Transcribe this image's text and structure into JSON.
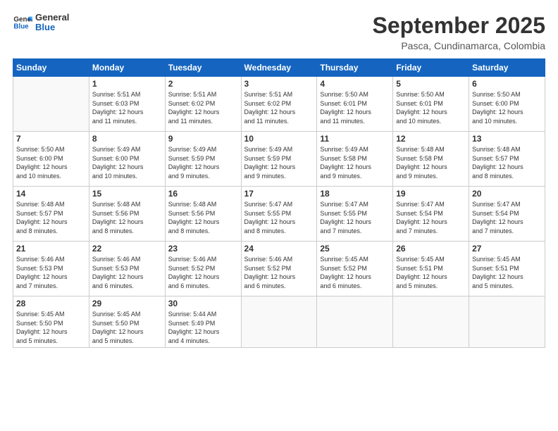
{
  "logo": {
    "line1": "General",
    "line2": "Blue"
  },
  "title": "September 2025",
  "subtitle": "Pasca, Cundinamarca, Colombia",
  "weekdays": [
    "Sunday",
    "Monday",
    "Tuesday",
    "Wednesday",
    "Thursday",
    "Friday",
    "Saturday"
  ],
  "weeks": [
    [
      {
        "day": "",
        "info": ""
      },
      {
        "day": "1",
        "info": "Sunrise: 5:51 AM\nSunset: 6:03 PM\nDaylight: 12 hours\nand 11 minutes."
      },
      {
        "day": "2",
        "info": "Sunrise: 5:51 AM\nSunset: 6:02 PM\nDaylight: 12 hours\nand 11 minutes."
      },
      {
        "day": "3",
        "info": "Sunrise: 5:51 AM\nSunset: 6:02 PM\nDaylight: 12 hours\nand 11 minutes."
      },
      {
        "day": "4",
        "info": "Sunrise: 5:50 AM\nSunset: 6:01 PM\nDaylight: 12 hours\nand 11 minutes."
      },
      {
        "day": "5",
        "info": "Sunrise: 5:50 AM\nSunset: 6:01 PM\nDaylight: 12 hours\nand 10 minutes."
      },
      {
        "day": "6",
        "info": "Sunrise: 5:50 AM\nSunset: 6:00 PM\nDaylight: 12 hours\nand 10 minutes."
      }
    ],
    [
      {
        "day": "7",
        "info": "Sunrise: 5:50 AM\nSunset: 6:00 PM\nDaylight: 12 hours\nand 10 minutes."
      },
      {
        "day": "8",
        "info": "Sunrise: 5:49 AM\nSunset: 6:00 PM\nDaylight: 12 hours\nand 10 minutes."
      },
      {
        "day": "9",
        "info": "Sunrise: 5:49 AM\nSunset: 5:59 PM\nDaylight: 12 hours\nand 9 minutes."
      },
      {
        "day": "10",
        "info": "Sunrise: 5:49 AM\nSunset: 5:59 PM\nDaylight: 12 hours\nand 9 minutes."
      },
      {
        "day": "11",
        "info": "Sunrise: 5:49 AM\nSunset: 5:58 PM\nDaylight: 12 hours\nand 9 minutes."
      },
      {
        "day": "12",
        "info": "Sunrise: 5:48 AM\nSunset: 5:58 PM\nDaylight: 12 hours\nand 9 minutes."
      },
      {
        "day": "13",
        "info": "Sunrise: 5:48 AM\nSunset: 5:57 PM\nDaylight: 12 hours\nand 8 minutes."
      }
    ],
    [
      {
        "day": "14",
        "info": "Sunrise: 5:48 AM\nSunset: 5:57 PM\nDaylight: 12 hours\nand 8 minutes."
      },
      {
        "day": "15",
        "info": "Sunrise: 5:48 AM\nSunset: 5:56 PM\nDaylight: 12 hours\nand 8 minutes."
      },
      {
        "day": "16",
        "info": "Sunrise: 5:48 AM\nSunset: 5:56 PM\nDaylight: 12 hours\nand 8 minutes."
      },
      {
        "day": "17",
        "info": "Sunrise: 5:47 AM\nSunset: 5:55 PM\nDaylight: 12 hours\nand 8 minutes."
      },
      {
        "day": "18",
        "info": "Sunrise: 5:47 AM\nSunset: 5:55 PM\nDaylight: 12 hours\nand 7 minutes."
      },
      {
        "day": "19",
        "info": "Sunrise: 5:47 AM\nSunset: 5:54 PM\nDaylight: 12 hours\nand 7 minutes."
      },
      {
        "day": "20",
        "info": "Sunrise: 5:47 AM\nSunset: 5:54 PM\nDaylight: 12 hours\nand 7 minutes."
      }
    ],
    [
      {
        "day": "21",
        "info": "Sunrise: 5:46 AM\nSunset: 5:53 PM\nDaylight: 12 hours\nand 7 minutes."
      },
      {
        "day": "22",
        "info": "Sunrise: 5:46 AM\nSunset: 5:53 PM\nDaylight: 12 hours\nand 6 minutes."
      },
      {
        "day": "23",
        "info": "Sunrise: 5:46 AM\nSunset: 5:52 PM\nDaylight: 12 hours\nand 6 minutes."
      },
      {
        "day": "24",
        "info": "Sunrise: 5:46 AM\nSunset: 5:52 PM\nDaylight: 12 hours\nand 6 minutes."
      },
      {
        "day": "25",
        "info": "Sunrise: 5:45 AM\nSunset: 5:52 PM\nDaylight: 12 hours\nand 6 minutes."
      },
      {
        "day": "26",
        "info": "Sunrise: 5:45 AM\nSunset: 5:51 PM\nDaylight: 12 hours\nand 5 minutes."
      },
      {
        "day": "27",
        "info": "Sunrise: 5:45 AM\nSunset: 5:51 PM\nDaylight: 12 hours\nand 5 minutes."
      }
    ],
    [
      {
        "day": "28",
        "info": "Sunrise: 5:45 AM\nSunset: 5:50 PM\nDaylight: 12 hours\nand 5 minutes."
      },
      {
        "day": "29",
        "info": "Sunrise: 5:45 AM\nSunset: 5:50 PM\nDaylight: 12 hours\nand 5 minutes."
      },
      {
        "day": "30",
        "info": "Sunrise: 5:44 AM\nSunset: 5:49 PM\nDaylight: 12 hours\nand 4 minutes."
      },
      {
        "day": "",
        "info": ""
      },
      {
        "day": "",
        "info": ""
      },
      {
        "day": "",
        "info": ""
      },
      {
        "day": "",
        "info": ""
      }
    ]
  ]
}
